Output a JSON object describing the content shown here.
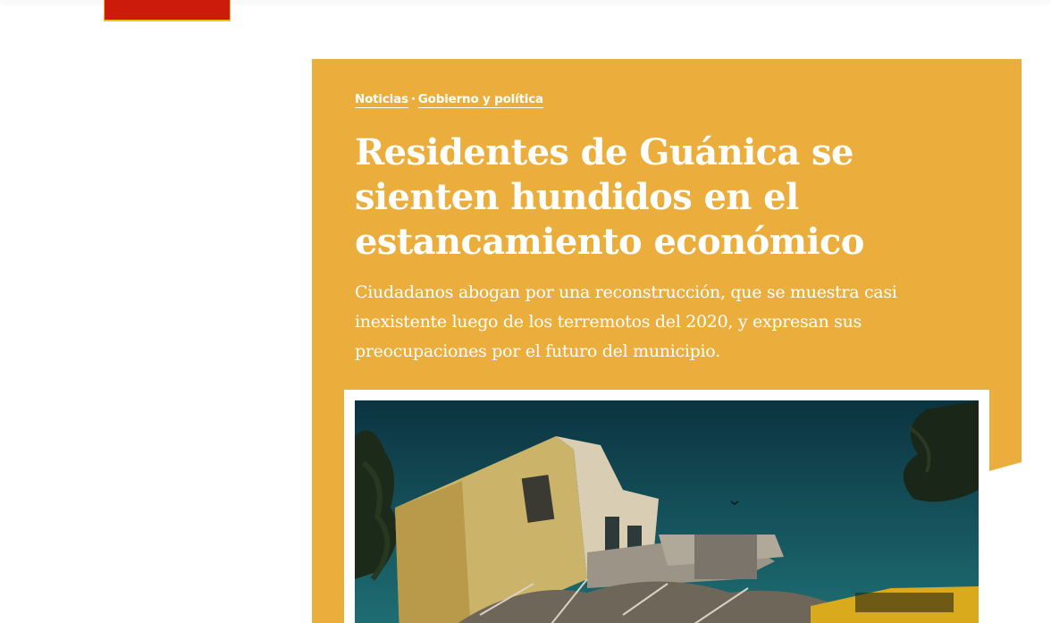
{
  "header": {
    "logo_color": "#cc1a0b"
  },
  "article": {
    "background_color": "#ebae3c",
    "breadcrumb": {
      "section": "Noticias",
      "separator": "·",
      "category": "Gobierno y política"
    },
    "headline": "Residentes de Guánica se sienten hundidos en el estancamiento económico",
    "dek": "Ciudadanos abogan por una reconstrucción, que se muestra casi inexistente luego de los terremotos del 2020, y expresan sus preocupaciones por el futuro del municipio.",
    "image": {
      "subject": "collapsed-building-photo"
    }
  }
}
